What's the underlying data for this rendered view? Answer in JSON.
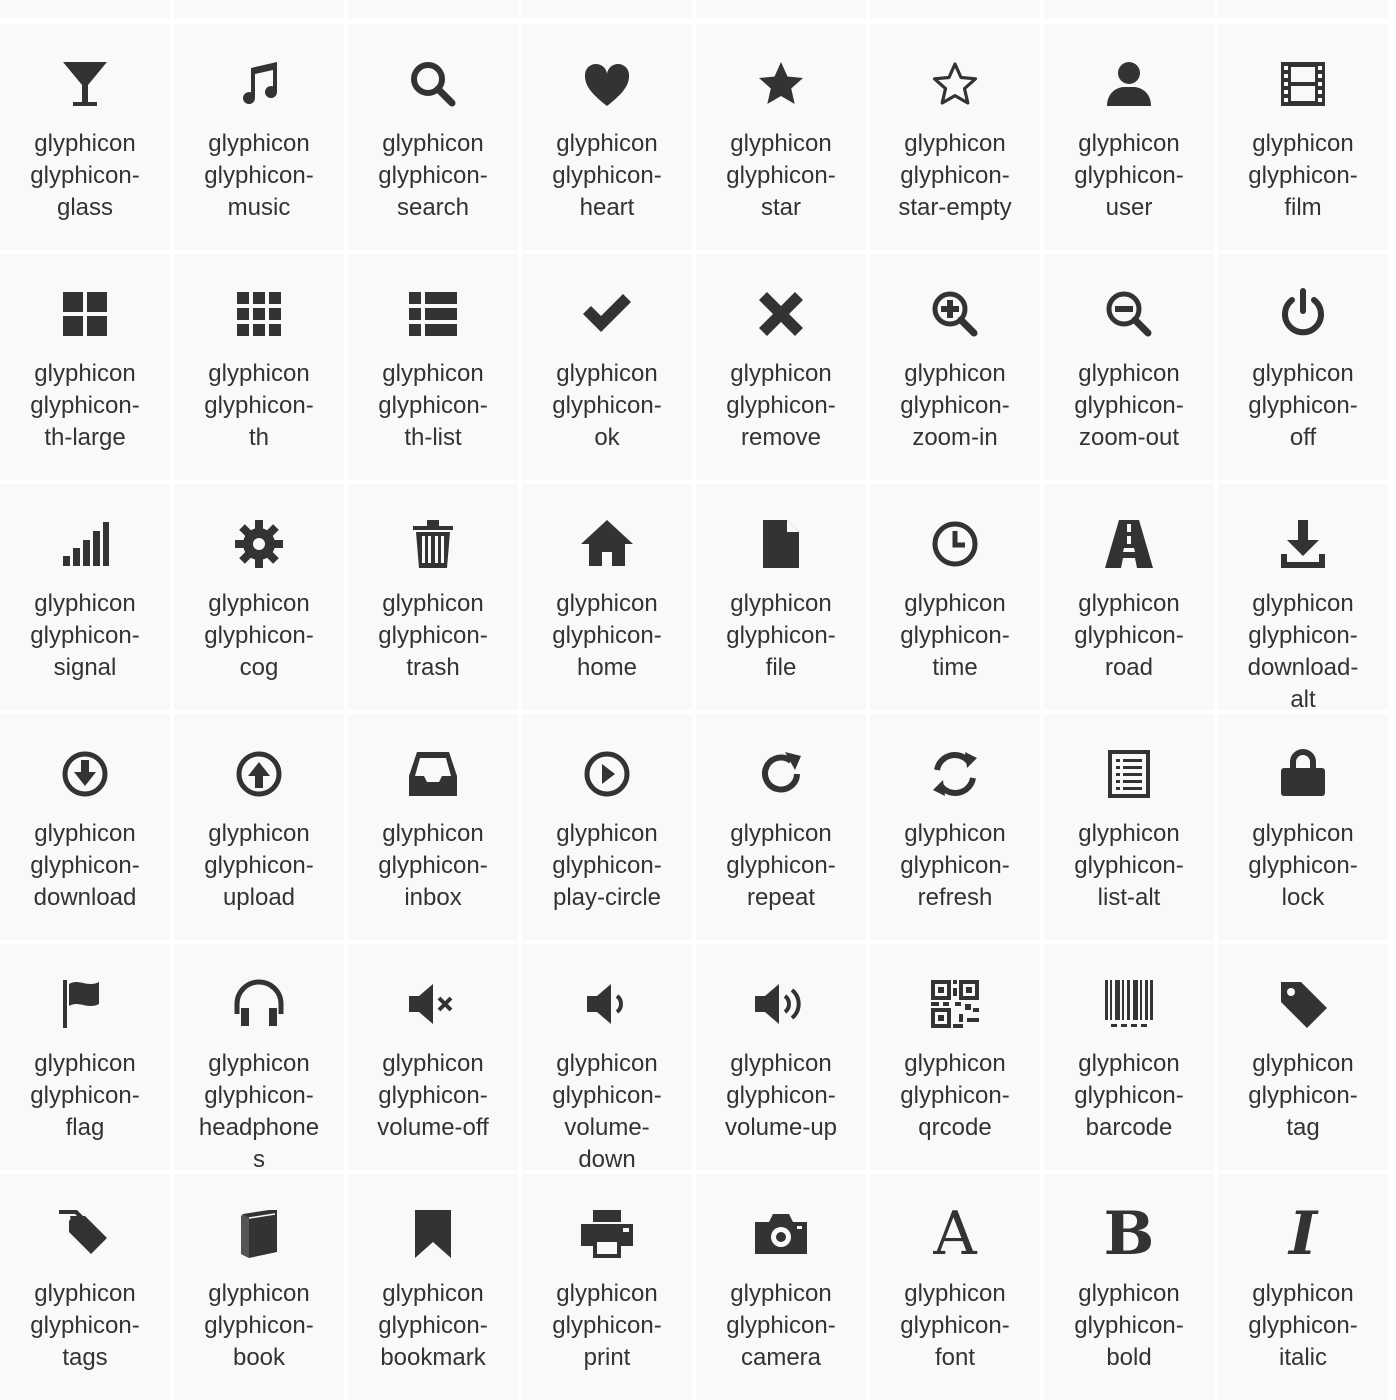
{
  "page": {
    "background": "#ffffff",
    "cell_background": "#f9f9f9",
    "icon_color": "#333333"
  },
  "label_prefix": "glyphicon",
  "icons": [
    {
      "name": "glass",
      "l2": "glyphicon-",
      "l3": "glass",
      "icon": "glass-icon"
    },
    {
      "name": "music",
      "l2": "glyphicon-",
      "l3": "music",
      "icon": "music-icon"
    },
    {
      "name": "search",
      "l2": "glyphicon-",
      "l3": "search",
      "icon": "search-icon"
    },
    {
      "name": "heart",
      "l2": "glyphicon-",
      "l3": "heart",
      "icon": "heart-icon"
    },
    {
      "name": "star",
      "l2": "glyphicon-",
      "l3": "star",
      "icon": "star-icon"
    },
    {
      "name": "star-empty",
      "l2": "glyphicon-",
      "l3": "star-empty",
      "icon": "star-empty-icon"
    },
    {
      "name": "user",
      "l2": "glyphicon-",
      "l3": "user",
      "icon": "user-icon"
    },
    {
      "name": "film",
      "l2": "glyphicon-",
      "l3": "film",
      "icon": "film-icon"
    },
    {
      "name": "th-large",
      "l2": "glyphicon-",
      "l3": "th-large",
      "icon": "th-large-icon"
    },
    {
      "name": "th",
      "l2": "glyphicon-",
      "l3": "th",
      "icon": "th-icon"
    },
    {
      "name": "th-list",
      "l2": "glyphicon-",
      "l3": "th-list",
      "icon": "th-list-icon"
    },
    {
      "name": "ok",
      "l2": "glyphicon-",
      "l3": "ok",
      "icon": "ok-icon"
    },
    {
      "name": "remove",
      "l2": "glyphicon-",
      "l3": "remove",
      "icon": "remove-icon"
    },
    {
      "name": "zoom-in",
      "l2": "glyphicon-",
      "l3": "zoom-in",
      "icon": "zoom-in-icon"
    },
    {
      "name": "zoom-out",
      "l2": "glyphicon-",
      "l3": "zoom-out",
      "icon": "zoom-out-icon"
    },
    {
      "name": "off",
      "l2": "glyphicon-",
      "l3": "off",
      "icon": "off-icon"
    },
    {
      "name": "signal",
      "l2": "glyphicon-",
      "l3": "signal",
      "icon": "signal-icon"
    },
    {
      "name": "cog",
      "l2": "glyphicon-",
      "l3": "cog",
      "icon": "cog-icon"
    },
    {
      "name": "trash",
      "l2": "glyphicon-",
      "l3": "trash",
      "icon": "trash-icon"
    },
    {
      "name": "home",
      "l2": "glyphicon-",
      "l3": "home",
      "icon": "home-icon"
    },
    {
      "name": "file",
      "l2": "glyphicon-",
      "l3": "file",
      "icon": "file-icon"
    },
    {
      "name": "time",
      "l2": "glyphicon-",
      "l3": "time",
      "icon": "time-icon"
    },
    {
      "name": "road",
      "l2": "glyphicon-",
      "l3": "road",
      "icon": "road-icon"
    },
    {
      "name": "download-alt",
      "l2": "glyphicon-",
      "l3": "download-",
      "l4": "alt",
      "icon": "download-alt-icon"
    },
    {
      "name": "download",
      "l2": "glyphicon-",
      "l3": "download",
      "icon": "download-icon"
    },
    {
      "name": "upload",
      "l2": "glyphicon-",
      "l3": "upload",
      "icon": "upload-icon"
    },
    {
      "name": "inbox",
      "l2": "glyphicon-",
      "l3": "inbox",
      "icon": "inbox-icon"
    },
    {
      "name": "play-circle",
      "l2": "glyphicon-",
      "l3": "play-circle",
      "icon": "play-circle-icon"
    },
    {
      "name": "repeat",
      "l2": "glyphicon-",
      "l3": "repeat",
      "icon": "repeat-icon"
    },
    {
      "name": "refresh",
      "l2": "glyphicon-",
      "l3": "refresh",
      "icon": "refresh-icon"
    },
    {
      "name": "list-alt",
      "l2": "glyphicon-",
      "l3": "list-alt",
      "icon": "list-alt-icon"
    },
    {
      "name": "lock",
      "l2": "glyphicon-",
      "l3": "lock",
      "icon": "lock-icon"
    },
    {
      "name": "flag",
      "l2": "glyphicon-",
      "l3": "flag",
      "icon": "flag-icon"
    },
    {
      "name": "headphones",
      "l2": "glyphicon-",
      "l3": "headphone",
      "l4": "s",
      "icon": "headphones-icon"
    },
    {
      "name": "volume-off",
      "l2": "glyphicon-",
      "l3": "volume-off",
      "icon": "volume-off-icon"
    },
    {
      "name": "volume-down",
      "l2": "glyphicon-",
      "l3": "volume-",
      "l4": "down",
      "icon": "volume-down-icon"
    },
    {
      "name": "volume-up",
      "l2": "glyphicon-",
      "l3": "volume-up",
      "icon": "volume-up-icon"
    },
    {
      "name": "qrcode",
      "l2": "glyphicon-",
      "l3": "qrcode",
      "icon": "qrcode-icon"
    },
    {
      "name": "barcode",
      "l2": "glyphicon-",
      "l3": "barcode",
      "icon": "barcode-icon"
    },
    {
      "name": "tag",
      "l2": "glyphicon-",
      "l3": "tag",
      "icon": "tag-icon"
    },
    {
      "name": "tags",
      "l2": "glyphicon-",
      "l3": "tags",
      "icon": "tags-icon"
    },
    {
      "name": "book",
      "l2": "glyphicon-",
      "l3": "book",
      "icon": "book-icon"
    },
    {
      "name": "bookmark",
      "l2": "glyphicon-",
      "l3": "bookmark",
      "icon": "bookmark-icon"
    },
    {
      "name": "print",
      "l2": "glyphicon-",
      "l3": "print",
      "icon": "print-icon"
    },
    {
      "name": "camera",
      "l2": "glyphicon-",
      "l3": "camera",
      "icon": "camera-icon"
    },
    {
      "name": "font",
      "l2": "glyphicon-",
      "l3": "font",
      "icon": "font-icon",
      "glyph": "A"
    },
    {
      "name": "bold",
      "l2": "glyphicon-",
      "l3": "bold",
      "icon": "bold-icon",
      "glyph": "B"
    },
    {
      "name": "italic",
      "l2": "glyphicon-",
      "l3": "italic",
      "icon": "italic-icon",
      "glyph": "I"
    }
  ]
}
